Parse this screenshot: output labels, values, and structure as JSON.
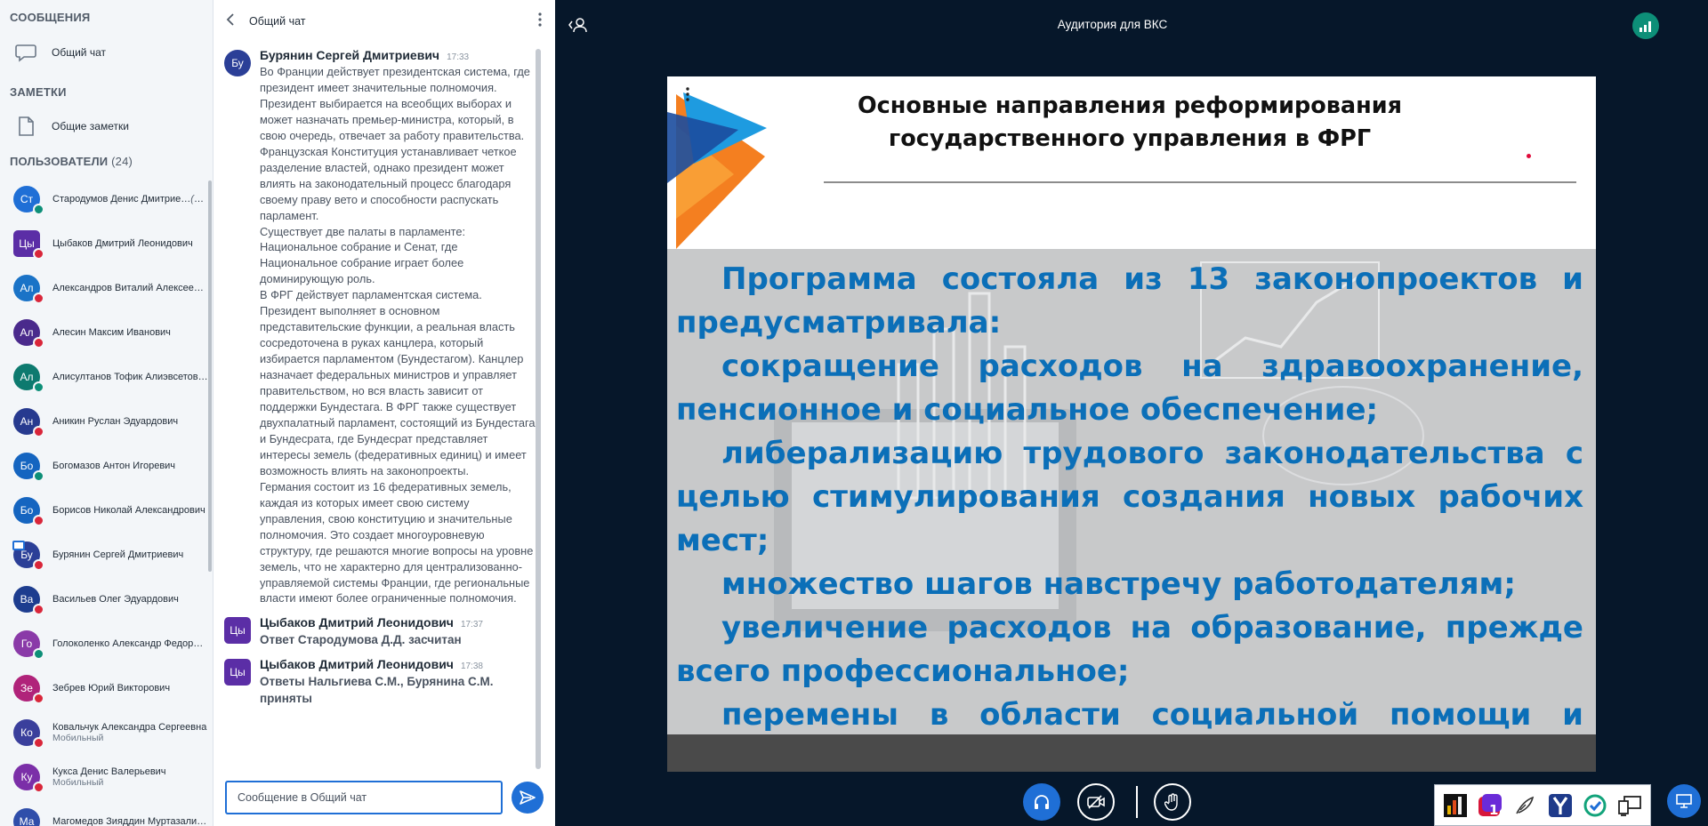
{
  "sidebar": {
    "messages_title": "СООБЩЕНИЯ",
    "public_chat": "Общий чат",
    "notes_title": "ЗАМЕТКИ",
    "shared_notes": "Общие заметки",
    "users_title": "ПОЛЬЗОВАТЕЛИ",
    "users_count": "(24)",
    "users": [
      {
        "initials": "Ст",
        "name": "Стародумов Денис Дмитрие…",
        "you": "(Вы)",
        "sub": "",
        "color": "#1f6fd6",
        "shape": "circle",
        "voice": "#0d8f78"
      },
      {
        "initials": "Цы",
        "name": "Цыбаков Дмитрий Леонидович",
        "you": "",
        "sub": "",
        "color": "#5b2ea6",
        "shape": "square",
        "voice": "#d9263a"
      },
      {
        "initials": "Ал",
        "name": "Александров Виталий Алексеевич",
        "you": "",
        "sub": "",
        "color": "#1a73c7",
        "shape": "circle",
        "voice": "#d9263a"
      },
      {
        "initials": "Ал",
        "name": "Алесин Максим Иванович",
        "you": "",
        "sub": "",
        "color": "#4a2a8c",
        "shape": "circle",
        "voice": "#d9263a"
      },
      {
        "initials": "Ал",
        "name": "Алисултанов Тофик Алиэвсетович",
        "you": "",
        "sub": "",
        "color": "#0d7a6f",
        "shape": "circle",
        "voice": "#0d8f78"
      },
      {
        "initials": "Ан",
        "name": "Аникин Руслан Эдуардович",
        "you": "",
        "sub": "",
        "color": "#273a8f",
        "shape": "circle",
        "voice": "#d9263a"
      },
      {
        "initials": "Бо",
        "name": "Богомазов Антон Игоревич",
        "you": "",
        "sub": "",
        "color": "#1565c0",
        "shape": "circle",
        "voice": "#0d8f78"
      },
      {
        "initials": "Бо",
        "name": "Борисов Николай Александрович",
        "you": "",
        "sub": "",
        "color": "#1565c0",
        "shape": "circle",
        "voice": "#d9263a"
      },
      {
        "initials": "Бу",
        "name": "Бурянин Сергей Дмитриевич",
        "you": "",
        "sub": "",
        "color": "#2b3f97",
        "shape": "circle",
        "voice": "#d9263a"
      },
      {
        "initials": "Ва",
        "name": "Васильев Олег Эдуардович",
        "you": "",
        "sub": "",
        "color": "#1d3d8f",
        "shape": "circle",
        "voice": "#d9263a"
      },
      {
        "initials": "Го",
        "name": "Голоколенко Александр Федоро…",
        "you": "",
        "sub": "",
        "color": "#8a3aa8",
        "shape": "circle",
        "voice": "#0d8f78"
      },
      {
        "initials": "Зе",
        "name": "Зебрев Юрий Викторович",
        "you": "",
        "sub": "",
        "color": "#b0237a",
        "shape": "circle",
        "voice": "#d9263a"
      },
      {
        "initials": "Ко",
        "name": "Ковальчук Александра Сергеевна",
        "you": "",
        "sub": "Мобильный",
        "color": "#3a3f9c",
        "shape": "circle",
        "voice": "#d9263a"
      },
      {
        "initials": "Ку",
        "name": "Кукса Денис Валерьевич",
        "you": "",
        "sub": "Мобильный",
        "color": "#7b2fa8",
        "shape": "circle",
        "voice": "#d9263a"
      },
      {
        "initials": "Ма",
        "name": "Магомедов Зияддин Муртазалие…",
        "you": "",
        "sub": "",
        "color": "#2f4eaa",
        "shape": "circle",
        "voice": "#d9263a"
      }
    ]
  },
  "chat": {
    "title": "Общий чат",
    "messages": [
      {
        "initials": "Бу",
        "author": "Бурянин Сергей Дмитриевич",
        "time": "17:33",
        "color": "#2b3f97",
        "shape": "circle",
        "text": "Во Франции действует президентская система, где президент имеет значительные полномочия. Президент выбирается на всеобщих выборах и может назначать премьер-министра, который, в свою очередь, отвечает за работу правительства. Французская Конституция устанавливает четкое разделение властей, однако президент может влиять на законодательный процесс благодаря своему праву вето и способности распускать парламент.\nСуществует две палаты в парламенте: Национальное собрание и Сенат, где Национальное собрание играет более доминирующую роль.\nВ ФРГ действует парламентская система. Президент выполняет в основном представительские функции, а реальная власть сосредоточена в руках канцлера, который избирается парламентом (Бундестагом). Канцлер назначает федеральных министров и управляет правительством, но вся власть зависит от поддержки Бундестага. В ФРГ также существует двухпалатный парламент, состоящий из Бундестага и Бундесрата, где Бундесрат представляет интересы земель (федеративных единиц) и имеет возможность влиять на законопроекты.\nГермания состоит из 16 федеративных земель, каждая из которых имеет свою систему управления, свою конституцию и значительные полномочия. Это создает многоуровневую структуру, где решаются многие вопросы на уровне земель, что не характерно для централизованно-управляемой системы Франции, где региональные власти имеют более ограниченные полномочия.",
        "bold": false
      },
      {
        "initials": "Цы",
        "author": "Цыбаков Дмитрий Леонидович",
        "time": "17:37",
        "color": "#5b2ea6",
        "shape": "square",
        "text": "Ответ Стародумова Д.Д. засчитан",
        "bold": true
      },
      {
        "initials": "Цы",
        "author": "Цыбаков Дмитрий Леонидович",
        "time": "17:38",
        "color": "#5b2ea6",
        "shape": "square",
        "text": "Ответы Нальгиева С.М., Бурянина С.М. приняты",
        "bold": true
      }
    ],
    "input_placeholder": "Сообщение в Общий чат"
  },
  "main": {
    "room_title": "Аудитория для ВКС",
    "slide": {
      "title": "Основные направления реформирования государственного управления в ФРГ",
      "paragraphs": [
        "Программа состояла из 13 законопроектов и предусматривала:",
        "сокращение расходов на здравоохранение, пенсионное и социальное обеспечение;",
        "либерализацию трудового законодательства с целью стимулирования создания новых рабочих мест;",
        "множество шагов навстречу работодателям;",
        "увеличение расходов на образование, прежде всего профессиональное;",
        "перемены в области социальной помощи и выплаты пособий по безработице."
      ]
    }
  },
  "colors": {
    "accent": "#1f6fd6",
    "slide_text": "#0b6fb8",
    "background": "#06172a"
  }
}
